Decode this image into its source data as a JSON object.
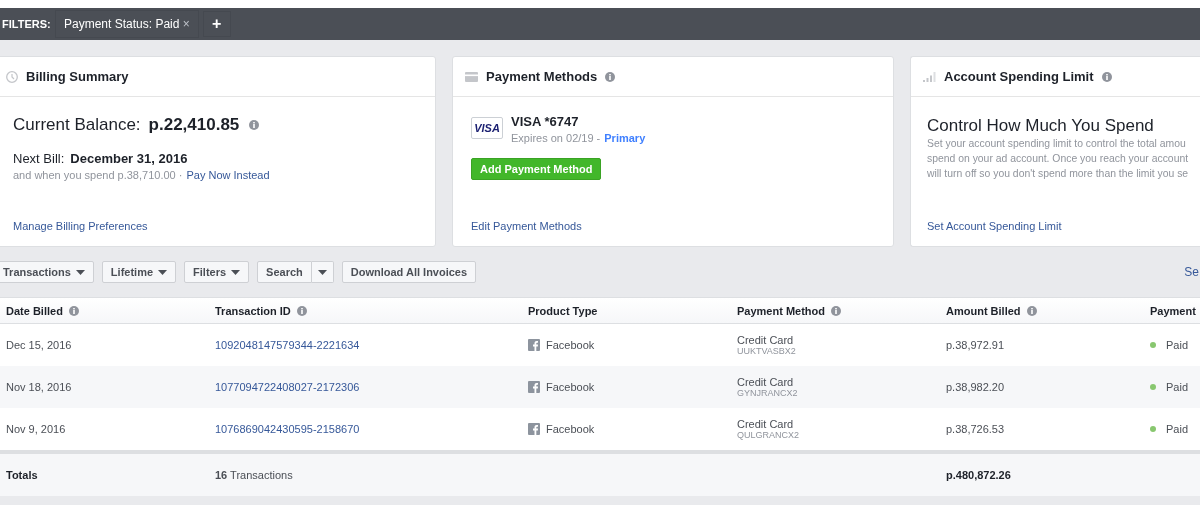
{
  "filter_bar": {
    "label": "FILTERS:",
    "chips": [
      {
        "field": "Payment Status:",
        "value": "Paid",
        "remove": "×"
      }
    ],
    "add": "+"
  },
  "billing_summary": {
    "title": "Billing Summary",
    "balance_label": "Current Balance:",
    "balance": "p.22,410.85",
    "next_bill_label": "Next Bill:",
    "next_bill": "December 31, 2016",
    "threshold": "and when you spend p.38,710.00 ·",
    "pay_now": "Pay Now Instead",
    "link": "Manage Billing Preferences"
  },
  "payment_methods": {
    "title": "Payment Methods",
    "card_brand": "VISA",
    "card_name": "VISA *6747",
    "expires": "Expires on 02/19 -",
    "primary": "Primary",
    "add_button": "Add Payment Method",
    "link": "Edit Payment Methods"
  },
  "spending_limit": {
    "title": "Account Spending Limit",
    "heading": "Control How Much You Spend",
    "lines": [
      "Set your account spending limit to control the total amou",
      "spend on your ad account. Once you reach your account",
      "will turn off so you don't spend more than the limit you se"
    ],
    "link": "Set Account Spending Limit"
  },
  "toolbar": {
    "dropdowns": [
      "Transactions",
      "Lifetime",
      "Filters"
    ],
    "search": "Search",
    "download": "Download All Invoices",
    "right_link": "Se"
  },
  "table": {
    "columns": [
      {
        "label": "Date Billed",
        "info": true
      },
      {
        "label": "Transaction ID",
        "info": true
      },
      {
        "label": "Product Type",
        "info": false
      },
      {
        "label": "Payment Method",
        "info": true
      },
      {
        "label": "Amount Billed",
        "info": true
      },
      {
        "label": "Payment",
        "info": false
      }
    ],
    "rows": [
      {
        "date": "Dec 15, 2016",
        "id": "1092048147579344-2221634",
        "product": "Facebook",
        "method": "Credit Card",
        "method_code": "UUKTVASBX2",
        "amount": "p.38,972.91",
        "status": "Paid",
        "color": "#88c76f"
      },
      {
        "date": "Nov 18, 2016",
        "id": "1077094722408027-2172306",
        "product": "Facebook",
        "method": "Credit Card",
        "method_code": "GYNJRANCX2",
        "amount": "p.38,982.20",
        "status": "Paid",
        "color": "#88c76f"
      },
      {
        "date": "Nov 9, 2016",
        "id": "1076869042430595-2158670",
        "product": "Facebook",
        "method": "Credit Card",
        "method_code": "QULGRANCX2",
        "amount": "p.38,726.53",
        "status": "Paid",
        "color": "#88c76f"
      }
    ],
    "totals": {
      "label": "Totals",
      "count": "16",
      "count_label": "Transactions",
      "amount": "p.480,872.26"
    }
  }
}
